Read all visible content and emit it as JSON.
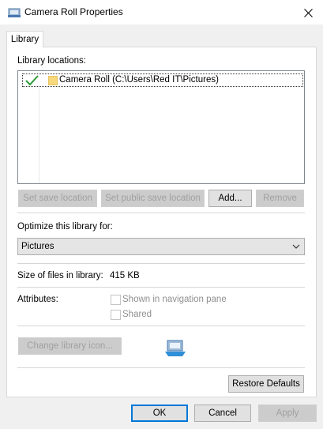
{
  "window": {
    "title": "Camera Roll Properties"
  },
  "tabs": [
    {
      "label": "Library",
      "active": true
    }
  ],
  "library": {
    "locations_label": "Library locations:",
    "locations": [
      {
        "name": "Camera Roll (C:\\Users\\Red IT\\Pictures)",
        "is_default_save": true,
        "icon": "folder-icon"
      }
    ],
    "buttons": {
      "set_save": "Set save location",
      "set_public_save": "Set public save location",
      "add": "Add...",
      "remove": "Remove"
    },
    "optimize_label": "Optimize this library for:",
    "optimize_value": "Pictures",
    "size_label": "Size of files in library:",
    "size_value": "415 KB",
    "attributes_label": "Attributes:",
    "attributes": [
      {
        "label": "Shown in navigation pane",
        "checked": false,
        "enabled": false
      },
      {
        "label": "Shared",
        "checked": false,
        "enabled": false
      }
    ],
    "change_icon_label": "Change library icon...",
    "restore_defaults_label": "Restore Defaults"
  },
  "footer": {
    "ok": "OK",
    "cancel": "Cancel",
    "apply": "Apply"
  },
  "colors": {
    "accent": "#0078d7",
    "check_green": "#2e9b3a"
  }
}
